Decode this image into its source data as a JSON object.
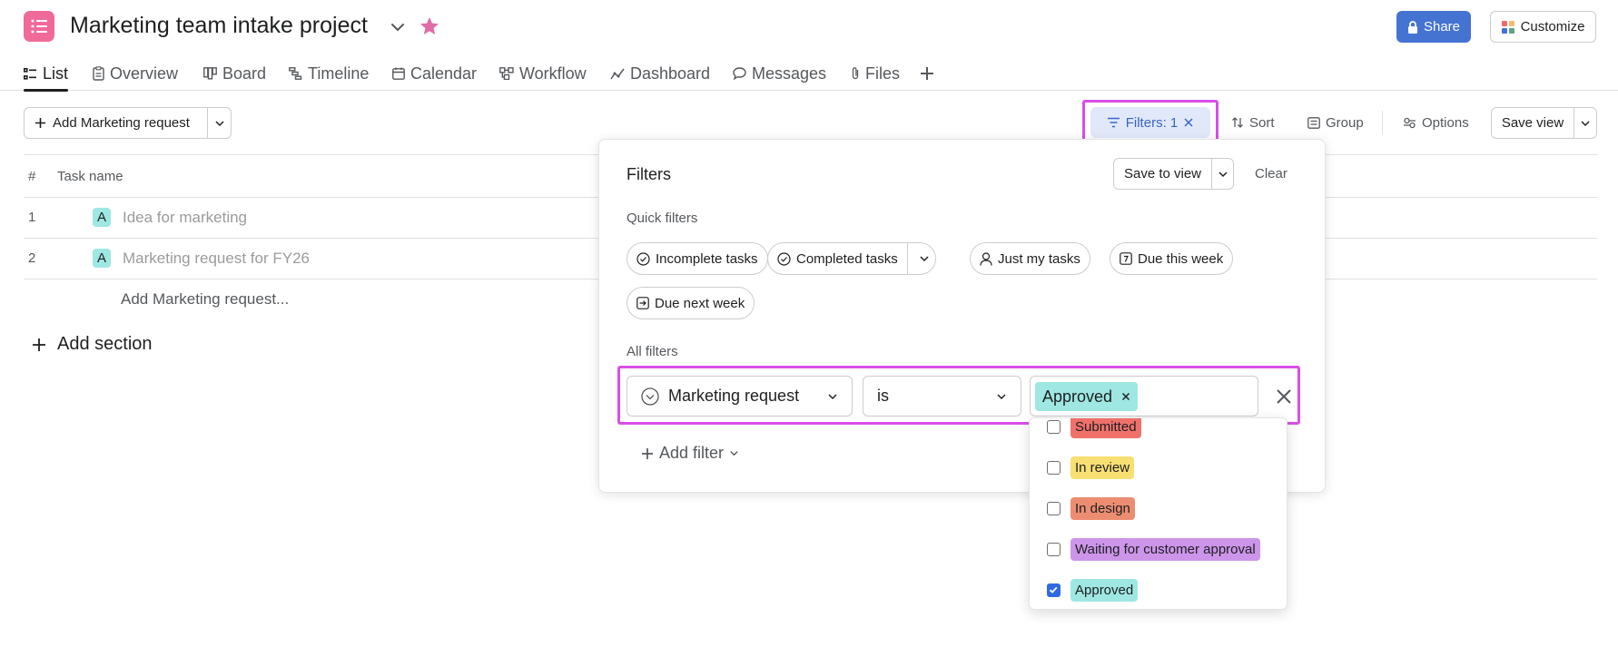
{
  "header": {
    "project_title": "Marketing team intake project",
    "share_label": "Share",
    "customize_label": "Customize",
    "brand_color": "#f06a99"
  },
  "tabs": [
    {
      "label": "List",
      "icon": "list-icon",
      "active": true
    },
    {
      "label": "Overview",
      "icon": "clipboard-icon"
    },
    {
      "label": "Board",
      "icon": "board-icon"
    },
    {
      "label": "Timeline",
      "icon": "timeline-icon"
    },
    {
      "label": "Calendar",
      "icon": "calendar-icon"
    },
    {
      "label": "Workflow",
      "icon": "workflow-icon"
    },
    {
      "label": "Dashboard",
      "icon": "dashboard-icon"
    },
    {
      "label": "Messages",
      "icon": "message-icon"
    },
    {
      "label": "Files",
      "icon": "paperclip-icon"
    }
  ],
  "toolbar": {
    "add_request_label": "Add Marketing request",
    "filters_label": "Filters: 1",
    "sort_label": "Sort",
    "group_label": "Group",
    "options_label": "Options",
    "save_view_label": "Save view"
  },
  "task_list": {
    "col_num": "#",
    "col_name": "Task name",
    "rows": [
      {
        "num": "1",
        "tag": "A",
        "name": "Idea for marketing"
      },
      {
        "num": "2",
        "tag": "A",
        "name": "Marketing request for FY26"
      }
    ],
    "add_row_label": "Add Marketing request...",
    "add_section_label": "Add section"
  },
  "filters_panel": {
    "title": "Filters",
    "save_to_view_label": "Save to view",
    "clear_label": "Clear",
    "quick_filters_label": "Quick filters",
    "quick_filters": [
      {
        "label": "Incomplete tasks",
        "icon": "check-circle-icon"
      },
      {
        "label": "Completed tasks",
        "icon": "check-circle-icon"
      },
      {
        "label": "Just my tasks",
        "icon": "person-icon"
      },
      {
        "label": "Due this week",
        "icon": "calendar-7-icon"
      },
      {
        "label": "Due next week",
        "icon": "calendar-arrow-icon"
      }
    ],
    "all_filters_label": "All filters",
    "field_label": "Marketing request",
    "operator_label": "is",
    "selected_value": "Approved",
    "add_filter_label": "Add filter"
  },
  "status_options": [
    {
      "label": "Submitted",
      "color": "#f0716a",
      "checked": false
    },
    {
      "label": "In review",
      "color": "#f8df72",
      "checked": false
    },
    {
      "label": "In design",
      "color": "#ec8d71",
      "checked": false
    },
    {
      "label": "Waiting for customer approval",
      "color": "#cd95ea",
      "checked": false
    },
    {
      "label": "Approved",
      "color": "#9ee7e3",
      "checked": true
    }
  ]
}
